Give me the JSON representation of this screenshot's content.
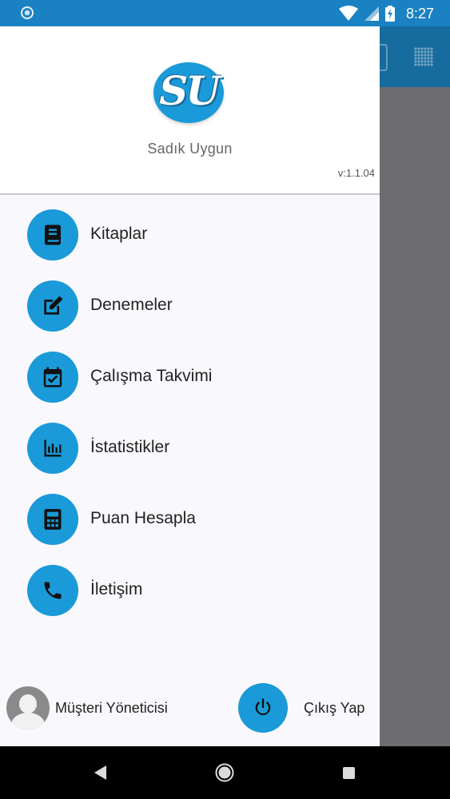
{
  "status_bar": {
    "time": "8:27"
  },
  "drawer": {
    "logo_text": "SU",
    "user_name": "Sadık Uygun",
    "version": "v:1.1.04",
    "menu": [
      {
        "label": "Kitaplar",
        "icon": "book-icon"
      },
      {
        "label": "Denemeler",
        "icon": "edit-icon"
      },
      {
        "label": "Çalışma Takvimi",
        "icon": "calendar-check-icon"
      },
      {
        "label": "İstatistikler",
        "icon": "bar-chart-icon"
      },
      {
        "label": "Puan Hesapla",
        "icon": "calculator-icon"
      },
      {
        "label": "İletişim",
        "icon": "phone-icon"
      }
    ],
    "footer": {
      "account_label": "Müşteri Yöneticisi",
      "logout_label": "Çıkış Yap"
    }
  },
  "colors": {
    "accent": "#1a9ad8",
    "status_bar": "#1a82c2",
    "scrim": "#6d6d70"
  }
}
